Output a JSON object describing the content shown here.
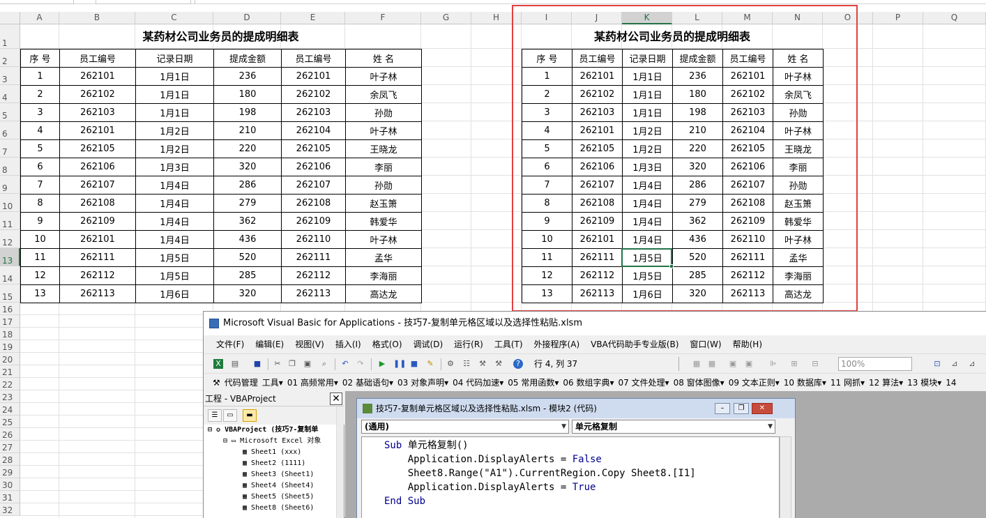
{
  "spreadsheet": {
    "columns": [
      "A",
      "B",
      "C",
      "D",
      "E",
      "F",
      "G",
      "H",
      "I",
      "J",
      "K",
      "L",
      "M",
      "N",
      "O",
      "P",
      "Q"
    ],
    "selected_column": "K",
    "rows": [
      "1",
      "2",
      "3",
      "4",
      "5",
      "6",
      "7",
      "8",
      "9",
      "10",
      "11",
      "12",
      "13",
      "14",
      "15",
      "16",
      "17",
      "18",
      "19",
      "20",
      "21",
      "22",
      "23",
      "24",
      "25",
      "26",
      "27",
      "28",
      "29",
      "30",
      "31",
      "32"
    ],
    "selected_row": "13",
    "table_title": "某药材公司业务员的提成明细表",
    "headers": [
      "序 号",
      "员工编号",
      "记录日期",
      "提成金额",
      "员工编号",
      "姓 名"
    ],
    "records": [
      [
        "1",
        "262101",
        "1月1日",
        "236",
        "262101",
        "叶子林"
      ],
      [
        "2",
        "262102",
        "1月1日",
        "180",
        "262102",
        "余凤飞"
      ],
      [
        "3",
        "262103",
        "1月1日",
        "198",
        "262103",
        "孙勋"
      ],
      [
        "4",
        "262101",
        "1月2日",
        "210",
        "262104",
        "叶子林"
      ],
      [
        "5",
        "262105",
        "1月2日",
        "220",
        "262105",
        "王晓龙"
      ],
      [
        "6",
        "262106",
        "1月3日",
        "320",
        "262106",
        "李丽"
      ],
      [
        "7",
        "262107",
        "1月4日",
        "286",
        "262107",
        "孙勋"
      ],
      [
        "8",
        "262108",
        "1月4日",
        "279",
        "262108",
        "赵玉箫"
      ],
      [
        "9",
        "262109",
        "1月4日",
        "362",
        "262109",
        "韩爱华"
      ],
      [
        "10",
        "262101",
        "1月4日",
        "436",
        "262110",
        "叶子林"
      ],
      [
        "11",
        "262111",
        "1月5日",
        "520",
        "262111",
        "孟华"
      ],
      [
        "12",
        "262112",
        "1月5日",
        "285",
        "262112",
        "李海丽"
      ],
      [
        "13",
        "262113",
        "1月6日",
        "320",
        "262113",
        "高达龙"
      ]
    ],
    "highlight_color": "#e04040",
    "selection_color": "#217346"
  },
  "vba": {
    "window_title": "Microsoft Visual Basic for Applications - 技巧7-复制单元格区域以及选择性粘贴.xlsm",
    "menu": [
      "文件(F)",
      "编辑(E)",
      "视图(V)",
      "插入(I)",
      "格式(O)",
      "调试(D)",
      "运行(R)",
      "工具(T)",
      "外接程序(A)",
      "VBA代码助手专业版(B)",
      "窗口(W)",
      "帮助(H)"
    ],
    "position": "行 4, 列 37",
    "zoom": "100%",
    "addin_toolbar": [
      "代码管理",
      "工具▾",
      "01 高频常用▾",
      "02 基础语句▾",
      "03 对象声明▾",
      "04 代码加速▾",
      "05 常用函数▾",
      "06 数组字典▾",
      "07 文件处理▾",
      "08 窗体图像▾",
      "09 文本正则▾",
      "10 数据库▾",
      "11 网抓▾",
      "12 算法▾",
      "13 模块▾",
      "14"
    ],
    "project_pane": {
      "title": "工程 - VBAProject",
      "tree": [
        "VBAProject (技巧7-复制单",
        "Microsoft Excel 对象",
        "Sheet1 (xxx)",
        "Sheet2 (1111)",
        "Sheet3 (Sheet1)",
        "Sheet4 (Sheet4)",
        "Sheet5 (Sheet5)",
        "Sheet8 (Sheet6)"
      ]
    },
    "code_window": {
      "title": "技巧7-复制单元格区域以及选择性粘贴.xlsm - 模块2 (代码)",
      "object_combo": "(通用)",
      "proc_combo": "单元格复制",
      "lines": [
        [
          "Sub ",
          "单元格复制()"
        ],
        [
          "    Application.DisplayAlerts = ",
          "False"
        ],
        [
          "    Sheet8.Range(\"A1\").CurrentRegion.Copy Sheet8.[I1]",
          ""
        ],
        [
          "    Application.DisplayAlerts = ",
          "True"
        ],
        [
          "End Sub",
          ""
        ]
      ]
    }
  }
}
